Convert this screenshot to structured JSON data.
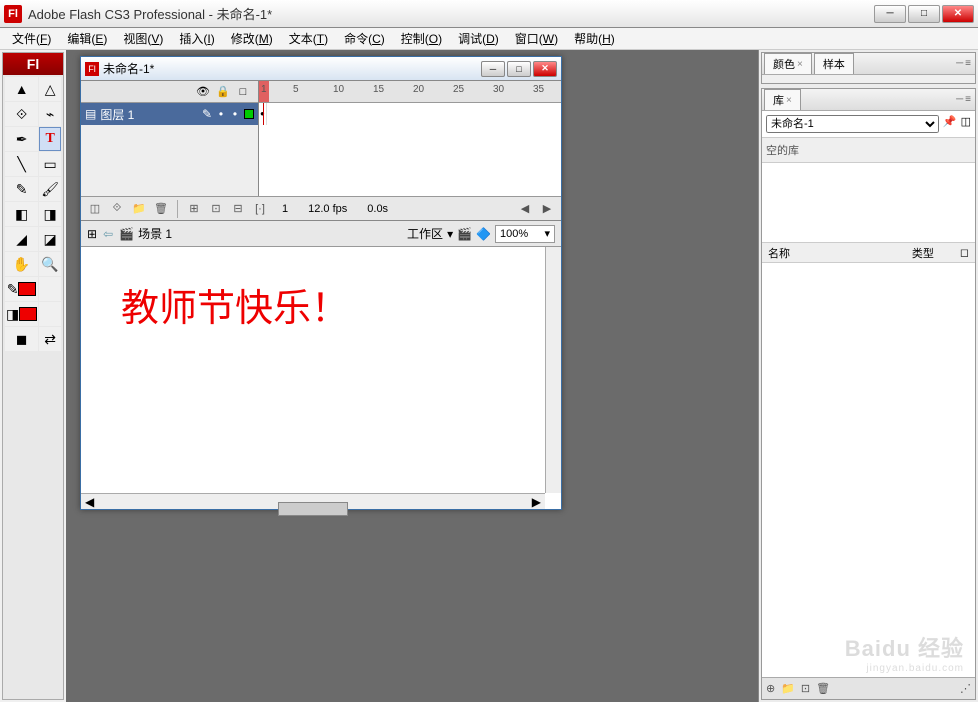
{
  "app": {
    "title": "Adobe Flash CS3 Professional - 未命名-1*",
    "logo": "Fl"
  },
  "menu": {
    "items": [
      {
        "label": "文件",
        "key": "F"
      },
      {
        "label": "编辑",
        "key": "E"
      },
      {
        "label": "视图",
        "key": "V"
      },
      {
        "label": "插入",
        "key": "I"
      },
      {
        "label": "修改",
        "key": "M"
      },
      {
        "label": "文本",
        "key": "T"
      },
      {
        "label": "命令",
        "key": "C"
      },
      {
        "label": "控制",
        "key": "O"
      },
      {
        "label": "调试",
        "key": "D"
      },
      {
        "label": "窗口",
        "key": "W"
      },
      {
        "label": "帮助",
        "key": "H"
      }
    ]
  },
  "tools": {
    "header": "Fl"
  },
  "doc": {
    "title": "未命名-1*",
    "scene": "场景 1",
    "workarea_label": "工作区",
    "zoom": "100%",
    "stage_text": "教师节快乐！"
  },
  "timeline": {
    "layer": "图层 1",
    "ruler": [
      1,
      5,
      10,
      15,
      20,
      25,
      30,
      35
    ],
    "status": {
      "frame": "1",
      "fps": "12.0 fps",
      "time": "0.0s"
    }
  },
  "panels": {
    "color": {
      "tab": "颜色"
    },
    "swatch": {
      "tab": "样本"
    },
    "library": {
      "tab": "库",
      "doc": "未命名-1",
      "empty": "空的库",
      "cols": {
        "name": "名称",
        "type": "类型"
      }
    }
  },
  "watermark": {
    "brand": "Baidu 经验",
    "url": "jingyan.baidu.com"
  }
}
